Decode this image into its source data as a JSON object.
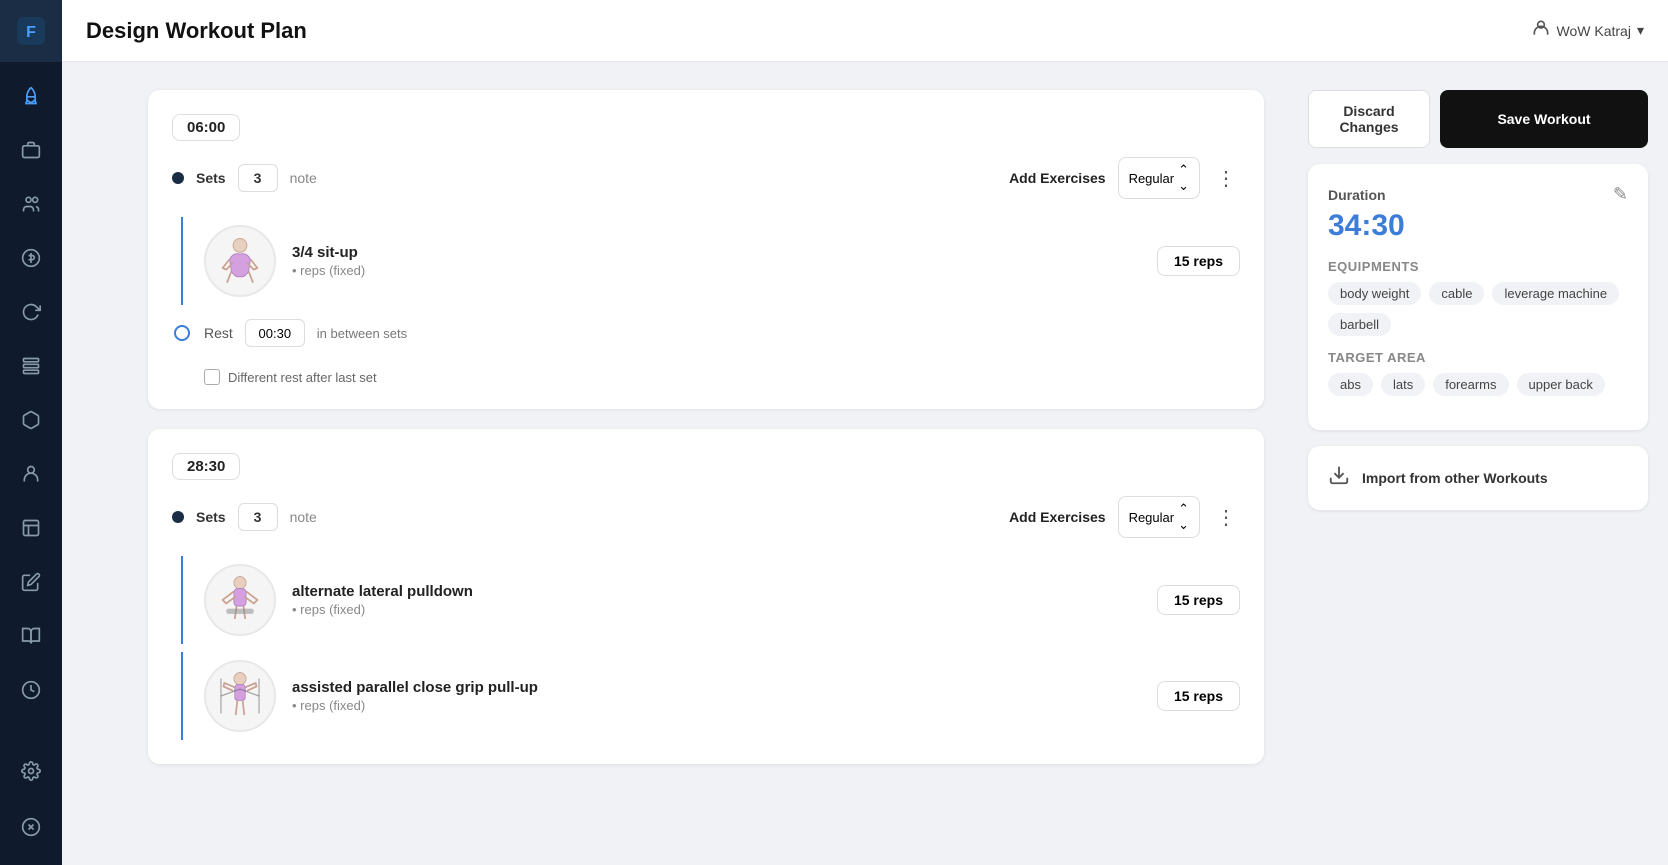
{
  "app": {
    "logo": "F",
    "title": "Design Workout Plan",
    "user": "WoW Katraj"
  },
  "sidebar": {
    "icons": [
      {
        "name": "rocket-icon",
        "glyph": "🚀",
        "active": true
      },
      {
        "name": "briefcase-icon",
        "glyph": "💼"
      },
      {
        "name": "users-icon",
        "glyph": "👥"
      },
      {
        "name": "dollar-icon",
        "glyph": "💰"
      },
      {
        "name": "refresh-icon",
        "glyph": "🔄"
      },
      {
        "name": "layers-icon",
        "glyph": "📋"
      },
      {
        "name": "cube-icon",
        "glyph": "📦"
      },
      {
        "name": "person-icon",
        "glyph": "👤"
      },
      {
        "name": "list-icon",
        "glyph": "📄"
      },
      {
        "name": "edit-icon",
        "glyph": "✏️"
      },
      {
        "name": "book-icon",
        "glyph": "📖"
      },
      {
        "name": "history-icon",
        "glyph": "🕐"
      }
    ],
    "bottom_icons": [
      {
        "name": "settings-gear-icon",
        "glyph": "⚙️"
      },
      {
        "name": "close-circle-icon",
        "glyph": "✕"
      }
    ]
  },
  "toolbar": {
    "discard_label": "Discard Changes",
    "save_label": "Save Workout"
  },
  "blocks": [
    {
      "time": "06:00",
      "sets_label": "Sets",
      "sets_value": "3",
      "note_label": "note",
      "add_exercises_label": "Add Exercises",
      "type_value": "Regular",
      "exercises": [
        {
          "name": "3/4 sit-up",
          "detail": "reps (fixed)",
          "reps_label": "15 reps"
        }
      ],
      "rest_label": "Rest",
      "rest_value": "00:30",
      "rest_between_label": "in between sets",
      "checkbox_label": "Different rest after last set"
    },
    {
      "time": "28:30",
      "sets_label": "Sets",
      "sets_value": "3",
      "note_label": "note",
      "add_exercises_label": "Add Exercises",
      "type_value": "Regular",
      "exercises": [
        {
          "name": "alternate lateral pulldown",
          "detail": "reps (fixed)",
          "reps_label": "15 reps"
        },
        {
          "name": "assisted parallel close grip pull-up",
          "detail": "reps (fixed)",
          "reps_label": "15 reps"
        }
      ],
      "rest_label": "",
      "rest_value": "",
      "rest_between_label": "",
      "checkbox_label": ""
    }
  ],
  "info": {
    "duration_label": "Duration",
    "duration_value": "34:30",
    "equipments_label": "Equipments",
    "equipments": [
      "body weight",
      "cable",
      "leverage machine",
      "barbell"
    ],
    "target_label": "Target Area",
    "targets": [
      "abs",
      "lats",
      "forearms",
      "upper back"
    ]
  },
  "import": {
    "label": "Import from other Workouts"
  }
}
